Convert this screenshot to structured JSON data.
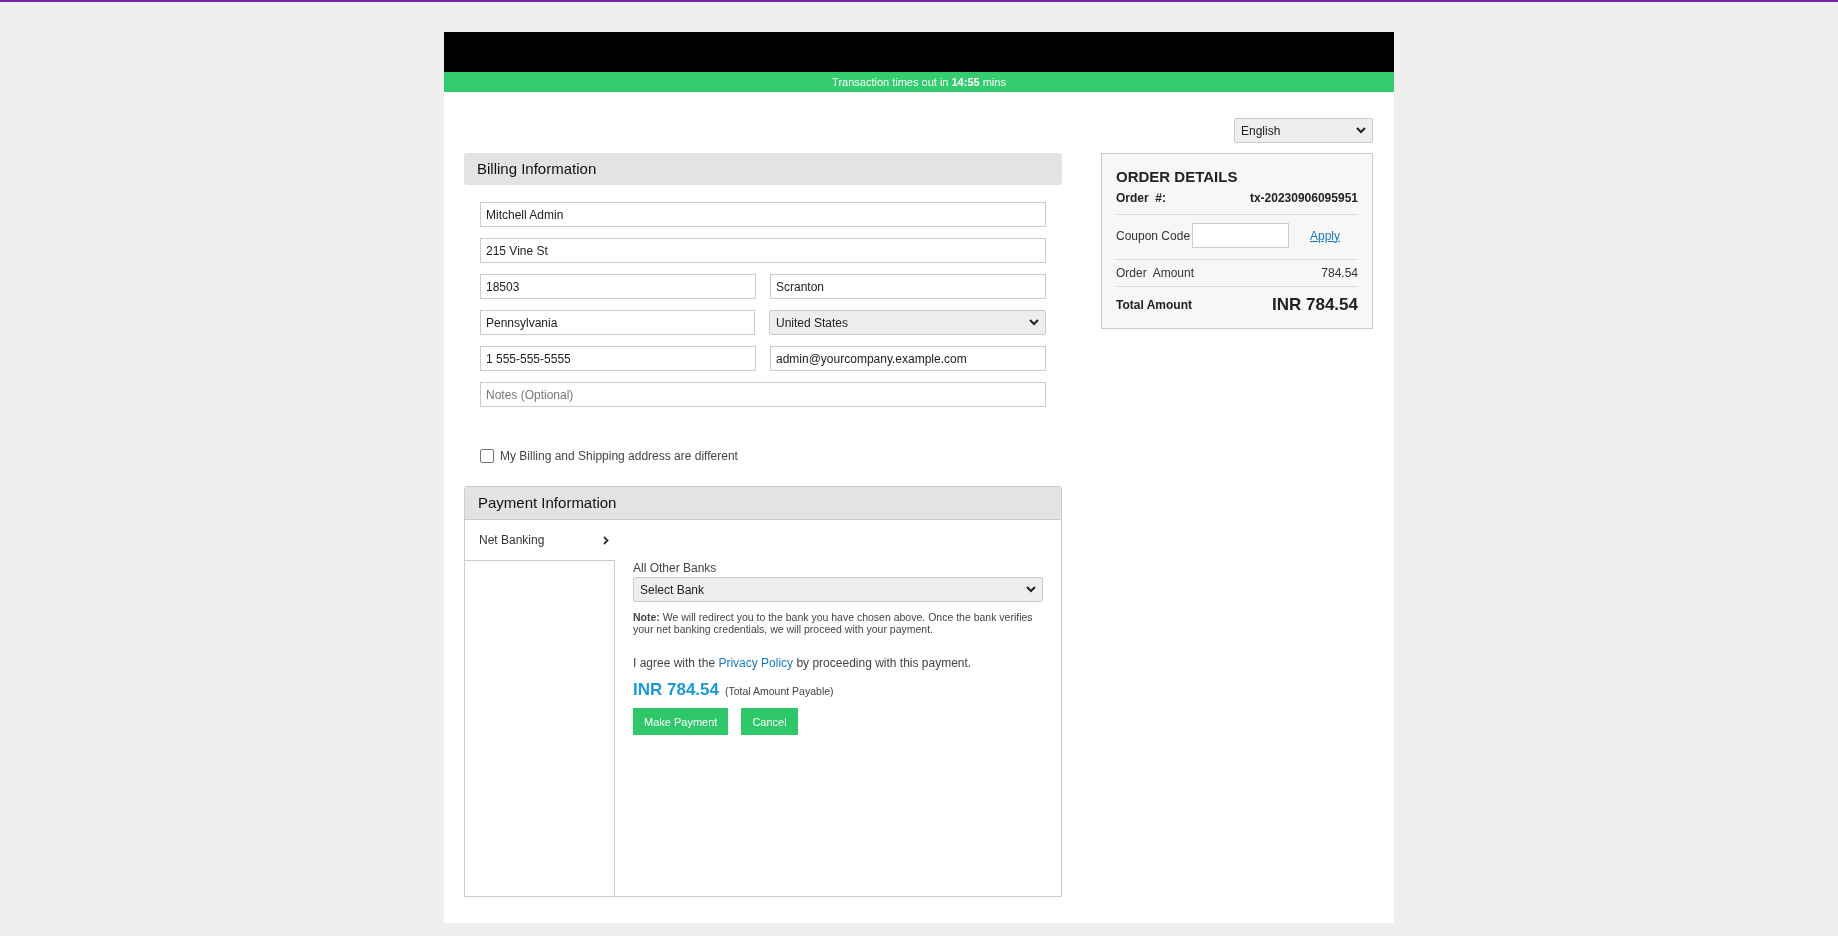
{
  "timer": {
    "text": "Transaction times out in **14:55** mins"
  },
  "language": {
    "value": "English"
  },
  "billing": {
    "title": "Billing Information",
    "rows": [
      [
        {
          "kind": "input",
          "value": "Mitchell Admin"
        }
      ],
      [
        {
          "kind": "input",
          "value": "215 Vine St"
        }
      ],
      [
        {
          "kind": "input",
          "value": "18503"
        },
        {
          "kind": "input",
          "value": "Scranton"
        }
      ],
      [
        {
          "kind": "input",
          "value": "Pennsylvania"
        },
        {
          "kind": "select",
          "value": "United States"
        }
      ],
      [
        {
          "kind": "input",
          "value": "1 555-555-5555"
        },
        {
          "kind": "input",
          "value": "admin@yourcompany.example.com"
        }
      ],
      [
        {
          "kind": "input",
          "placeholder": "Notes (Optional)"
        }
      ]
    ],
    "different_address": {
      "label": "My Billing and Shipping address are different",
      "checked": false
    }
  },
  "payment": {
    "title": "Payment Information",
    "methods": [
      {
        "label": "Net Banking",
        "selected": true
      }
    ],
    "bank_label": "All Other Banks",
    "bank_select": "Select Bank",
    "note": "**Note:** We will redirect you to the bank you have chosen above. Once the bank verifies your net banking credentials, we will proceed with your payment.",
    "agree_before": "I agree with the",
    "agree_link": "Privacy Policy",
    "agree_after": "by proceeding with this payment.",
    "amount": "INR 784.54",
    "amount_caption": "(Total Amount Payable)",
    "buttons": [
      "Make Payment",
      "Cancel"
    ]
  },
  "order": {
    "title": "ORDER DETAILS",
    "order_label": "Order  #:",
    "order_number": "tx-20230906095951",
    "coupon_label": "Coupon Code",
    "apply": "Apply",
    "amount_label": "Order  Amount",
    "amount": "784.54",
    "total_label": "Total Amount",
    "total": "INR 784.54"
  }
}
